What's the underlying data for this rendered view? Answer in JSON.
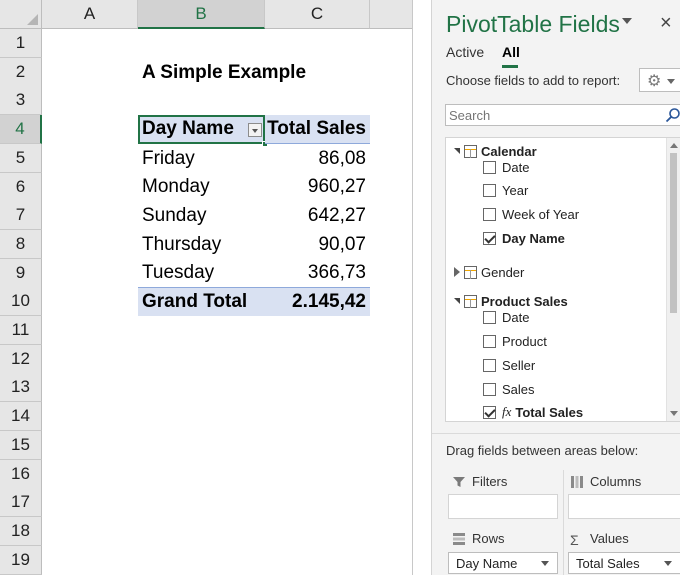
{
  "sheet": {
    "columns": [
      "A",
      "B",
      "C"
    ],
    "rows": [
      "1",
      "2",
      "3",
      "4",
      "5",
      "6",
      "7",
      "8",
      "9",
      "10",
      "11",
      "12",
      "13",
      "14",
      "15",
      "16",
      "17",
      "18",
      "19"
    ],
    "title": "A Simple Example",
    "pivot": {
      "header_row": "Day Name",
      "header_value": "Total Sales",
      "rows": [
        {
          "label": "Friday",
          "value": "86,08"
        },
        {
          "label": "Monday",
          "value": "960,27"
        },
        {
          "label": "Sunday",
          "value": "642,27"
        },
        {
          "label": "Thursday",
          "value": "90,07"
        },
        {
          "label": "Tuesday",
          "value": "366,73"
        }
      ],
      "total_label": "Grand Total",
      "total_value": "2.145,42"
    },
    "selected_column": "B",
    "selected_row": "4",
    "accent_color": "#217346"
  },
  "panel": {
    "title": "PivotTable Fields",
    "close": "×",
    "tabs": [
      {
        "label": "Active"
      },
      {
        "label": "All"
      }
    ],
    "choose_label": "Choose fields to add to report:",
    "gear_icon": "⚙",
    "search_placeholder": "Search",
    "tables": [
      {
        "name": "Calendar",
        "fields": [
          {
            "name": "Date",
            "checked": false
          },
          {
            "name": "Year",
            "checked": false
          },
          {
            "name": "Week of Year",
            "checked": false
          },
          {
            "name": "Day Name",
            "checked": true
          }
        ]
      },
      {
        "name": "Gender",
        "fields": []
      },
      {
        "name": "Product Sales",
        "fields": [
          {
            "name": "Date",
            "checked": false
          },
          {
            "name": "Product",
            "checked": false
          },
          {
            "name": "Seller",
            "checked": false
          },
          {
            "name": "Sales",
            "checked": false
          },
          {
            "name": "Total Sales",
            "checked": true,
            "measure": true
          }
        ]
      }
    ],
    "fx_symbol": "fx",
    "drag_label": "Drag fields between areas below:",
    "areas": {
      "filters": "Filters",
      "columns": "Columns",
      "rows": "Rows",
      "values": "Values",
      "values_symbol": "Σ",
      "rows_field": "Day Name",
      "values_field": "Total Sales"
    }
  }
}
